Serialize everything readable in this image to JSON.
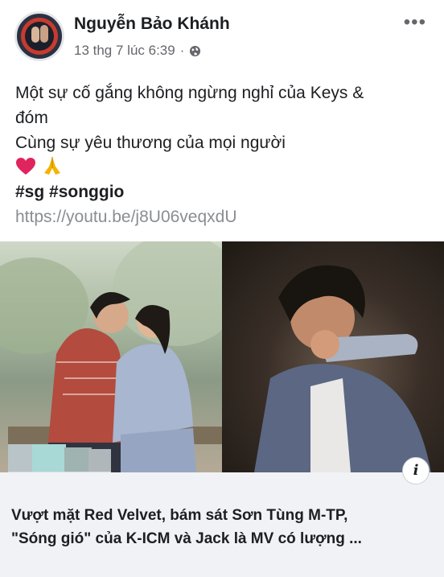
{
  "post": {
    "author": "Nguyễn Bảo Khánh",
    "timestamp": "13 thg 7 lúc 6:39",
    "separator": "·",
    "privacy_icon": "globe-icon",
    "more_icon": "more-horizontal-icon",
    "more_label": "•••",
    "text_lines": [
      "Một sự cố gắng không ngừng nghỉ của Keys &",
      "đóm",
      "Cùng sự yêu thương của mọi người"
    ],
    "emojis": [
      "heart-emoji",
      "folded-hands-emoji"
    ],
    "hashtags": "#sg #songgio",
    "link": "https://youtu.be/j8U06veqxdU"
  },
  "link_preview": {
    "info_icon": "info-icon",
    "info_label": "i",
    "title_lines": [
      "Vượt mặt Red Velvet, bám sát Sơn Tùng M-TP,",
      "\"Sóng gió\" của K-ICM và Jack là MV có lượng ..."
    ]
  },
  "colors": {
    "text": "#1c1e21",
    "secondary": "#65676b",
    "link": "#8a8d91",
    "preview_bg": "#f0f2f5",
    "heart": "#e0245e",
    "hands": "#f4b400"
  }
}
